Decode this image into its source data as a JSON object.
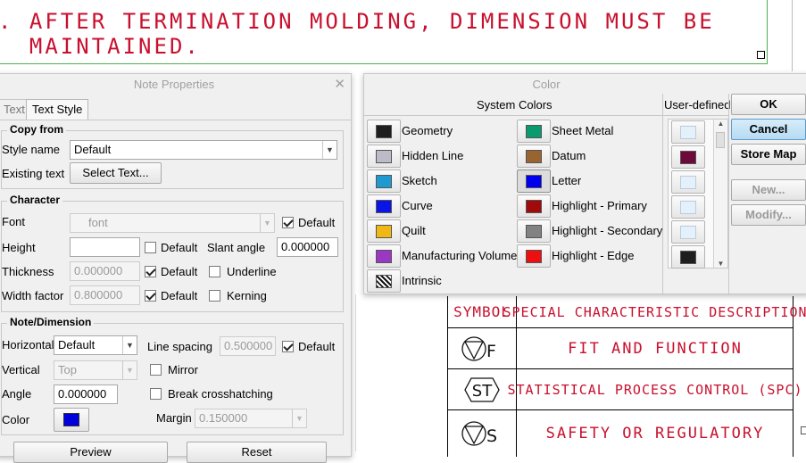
{
  "drawing": {
    "note_line1": ". AFTER TERMINATION MOLDING, DIMENSION MUST BE",
    "note_line2": "  MAINTAINED.",
    "table": {
      "headers": [
        "SYMBOL",
        "SPECIAL CHARACTERISTIC DESCRIPTION"
      ],
      "rows": [
        {
          "symbol_letter": "F",
          "description": "FIT AND FUNCTION"
        },
        {
          "symbol_letter": "ST",
          "description": "STATISTICAL PROCESS CONTROL (SPC)"
        },
        {
          "symbol_letter": "S",
          "description": "SAFETY OR REGULATORY"
        }
      ]
    },
    "colors": {
      "annotation": "#c8102e",
      "frame": "#4caf50"
    }
  },
  "note_props": {
    "title": "Note Properties",
    "tabs": [
      "Text",
      "Text Style"
    ],
    "active_tab": "Text Style",
    "copy_from": {
      "title": "Copy from",
      "style_name_label": "Style name",
      "style_name_value": "Default",
      "existing_text_label": "Existing text",
      "select_text_button": "Select Text..."
    },
    "character": {
      "title": "Character",
      "font_label": "Font",
      "font_value": "font",
      "default_label": "Default",
      "height_label": "Height",
      "height_value": "",
      "slant_label": "Slant angle",
      "slant_value": "0.000000",
      "thickness_label": "Thickness",
      "thickness_value": "0.000000",
      "underline_label": "Underline",
      "width_factor_label": "Width factor",
      "width_factor_value": "0.800000",
      "kerning_label": "Kerning"
    },
    "note_dimension": {
      "title": "Note/Dimension",
      "horizontal_label": "Horizontal",
      "horizontal_value": "Default",
      "line_spacing_label": "Line spacing",
      "line_spacing_value": "0.500000",
      "vertical_label": "Vertical",
      "vertical_value": "Top",
      "mirror_label": "Mirror",
      "angle_label": "Angle",
      "angle_value": "0.000000",
      "break_label": "Break crosshatching",
      "color_label": "Color",
      "color_value": "#0000dd",
      "margin_label": "Margin",
      "margin_value": "0.150000"
    },
    "buttons": {
      "preview": "Preview",
      "reset": "Reset"
    }
  },
  "color_dialog": {
    "title": "Color",
    "system_header": "System Colors",
    "user_header": "User-defined",
    "system_colors": [
      {
        "name": "Geometry",
        "color": "#1e1e1e"
      },
      {
        "name": "Hidden Line",
        "color": "#bcbcc8"
      },
      {
        "name": "Sketch",
        "color": "#1e9ad0"
      },
      {
        "name": "Curve",
        "color": "#0a14e6"
      },
      {
        "name": "Quilt",
        "color": "#f0b814"
      },
      {
        "name": "Manufacturing Volume",
        "color": "#9a38c4"
      },
      {
        "name": "Intrinsic",
        "color": "hatch"
      },
      {
        "name": "Sheet Metal",
        "color": "#0a9a6e"
      },
      {
        "name": "Datum",
        "color": "#9a6430"
      },
      {
        "name": "Letter",
        "color": "#0000ee"
      },
      {
        "name": "Highlight - Primary",
        "color": "#a00a0a"
      },
      {
        "name": "Highlight - Secondary",
        "color": "#828282"
      },
      {
        "name": "Highlight - Edge",
        "color": "#ee1010"
      }
    ],
    "selected": "Letter",
    "user_colors": [
      "#e4f0fa",
      "#6e0a3a",
      "#e4f0fa",
      "#e4f0fa",
      "#e4f0fa",
      "#1e1e1e"
    ],
    "buttons": {
      "ok": "OK",
      "cancel": "Cancel",
      "store_map": "Store Map",
      "new": "New...",
      "modify": "Modify..."
    }
  }
}
